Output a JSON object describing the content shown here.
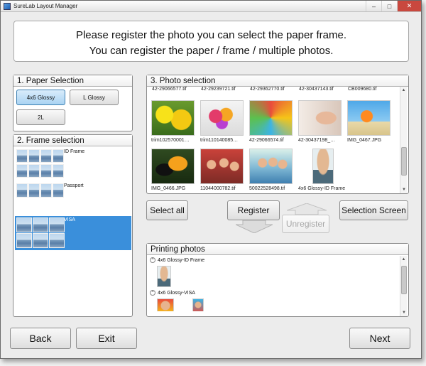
{
  "window": {
    "title": "SureLab Layout Manager",
    "minimize": "–",
    "maximize": "□",
    "close": "✕"
  },
  "instructions": {
    "line1": "Please register the photo you can select the paper frame.",
    "line2": "You can register the paper / frame / multiple photos."
  },
  "paper_selection": {
    "title": "1. Paper Selection",
    "options": [
      {
        "label": "4x6 Glossy",
        "selected": true
      },
      {
        "label": "L Glossy",
        "selected": false
      },
      {
        "label": "2L",
        "selected": false
      }
    ]
  },
  "frame_selection": {
    "title": "2. Frame selection",
    "items": [
      {
        "label": "ID Frame",
        "selected": false
      },
      {
        "label": "Passport",
        "selected": false
      },
      {
        "label": "VISA",
        "selected": true
      }
    ]
  },
  "photo_selection": {
    "title": "3. Photo selection",
    "cut_labels": [
      "42-29066577.tif",
      "42-29239721.tif",
      "42-29362770.tif",
      "42-30437143.tif",
      "CB009680.tif"
    ],
    "photos": [
      {
        "label": "trim102570001…",
        "icon": "yellow-flowers"
      },
      {
        "label": "trim110140085…",
        "icon": "flower-bouquet"
      },
      {
        "label": "42-29066574.tif",
        "icon": "kids-circle"
      },
      {
        "label": "42-30437198_…",
        "icon": "woman-lying"
      },
      {
        "label": "IMG_0467.JPG",
        "icon": "beach-jump"
      },
      {
        "label": "IMG_0466.JPG",
        "icon": "toucan"
      },
      {
        "label": "11044000782.tif",
        "icon": "crowd"
      },
      {
        "label": "50022528498.tif",
        "icon": "family-group"
      },
      {
        "label": "4x6 Glossy-ID Frame",
        "icon": "id-portrait"
      }
    ]
  },
  "actions": {
    "select_all": "Select all",
    "register": "Register",
    "unregister": "Unregister",
    "selection_screen": "Selection Screen"
  },
  "printing": {
    "title": "Printing photos",
    "groups": [
      {
        "label": "4x6 Glossy-ID Frame",
        "toggle": "^"
      },
      {
        "label": "4x6 Glossy-VISA",
        "toggle": "^"
      }
    ]
  },
  "footer": {
    "back": "Back",
    "exit": "Exit",
    "next": "Next"
  },
  "colors": {
    "selection_blue": "#3a8fdb",
    "panel_border": "#8a8a8a",
    "close_red": "#c9483e"
  }
}
